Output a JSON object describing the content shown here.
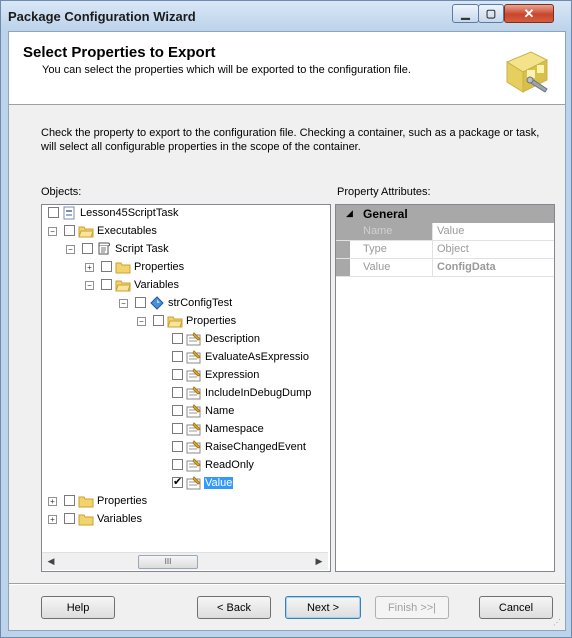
{
  "window": {
    "title": "Package Configuration Wizard"
  },
  "header": {
    "title": "Select Properties to Export",
    "subtitle": "You can select the properties which will be exported to the configuration file."
  },
  "instructions": "Check the property to export to the configuration file. Checking a container, such as a package or task, will select all configurable properties in the scope of the container.",
  "objects_label": "Objects:",
  "property_attributes_label": "Property Attributes:",
  "tree": {
    "package": "Lesson45ScriptTask",
    "executables": "Executables",
    "script_task": "Script Task",
    "st_properties": "Properties",
    "st_variables": "Variables",
    "variable": "strConfigTest",
    "var_properties": "Properties",
    "leaves": [
      "Description",
      "EvaluateAsExpressio",
      "Expression",
      "IncludeInDebugDump",
      "Name",
      "Namespace",
      "RaiseChangedEvent",
      "ReadOnly",
      "Value"
    ],
    "pkg_properties": "Properties",
    "pkg_variables": "Variables",
    "checked_leaf": "Value",
    "hscroll_thumb_glyph": "III"
  },
  "property_grid": {
    "category": "General",
    "rows": [
      {
        "name": "Name",
        "value": "Value"
      },
      {
        "name": "Type",
        "value": "Object"
      },
      {
        "name": "Value",
        "value": "ConfigData"
      }
    ]
  },
  "buttons": {
    "help": "Help",
    "back": "< Back",
    "next": "Next >",
    "finish": "Finish >>|",
    "cancel": "Cancel"
  },
  "icons": [
    "minimize-icon",
    "maximize-icon",
    "close-icon",
    "wizard-icon",
    "package-icon",
    "folder-icon",
    "script-task-icon",
    "variable-icon",
    "property-icon"
  ]
}
